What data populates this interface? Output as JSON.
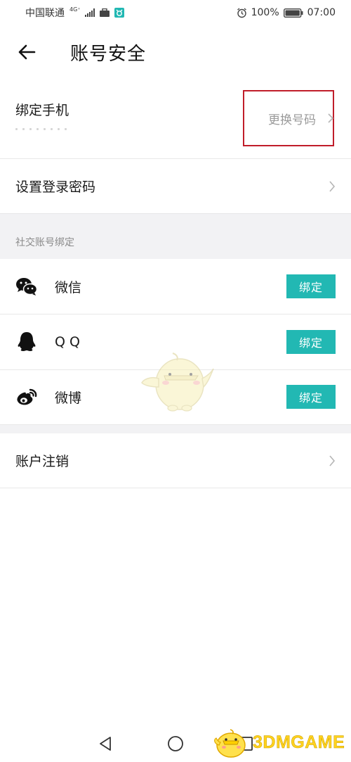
{
  "status_bar": {
    "carrier": "中国联通",
    "network_type": "4G⁺",
    "battery_percent": "100%",
    "time": "07:00"
  },
  "header": {
    "title": "账号安全"
  },
  "phone": {
    "label": "绑定手机",
    "change_label": "更换号码"
  },
  "password": {
    "label": "设置登录密码"
  },
  "social": {
    "section_title": "社交账号绑定",
    "items": [
      {
        "label": "微信",
        "button": "绑定",
        "icon": "wechat-icon"
      },
      {
        "label": "Q Q",
        "button": "绑定",
        "icon": "qq-icon"
      },
      {
        "label": "微博",
        "button": "绑定",
        "icon": "weibo-icon"
      }
    ]
  },
  "account": {
    "cancel_label": "账户注销"
  },
  "watermark": {
    "text": "3DMGAME"
  },
  "colors": {
    "accent": "#22b8b3",
    "highlight_border": "#c01d2a",
    "section_bg": "#f2f2f4"
  }
}
